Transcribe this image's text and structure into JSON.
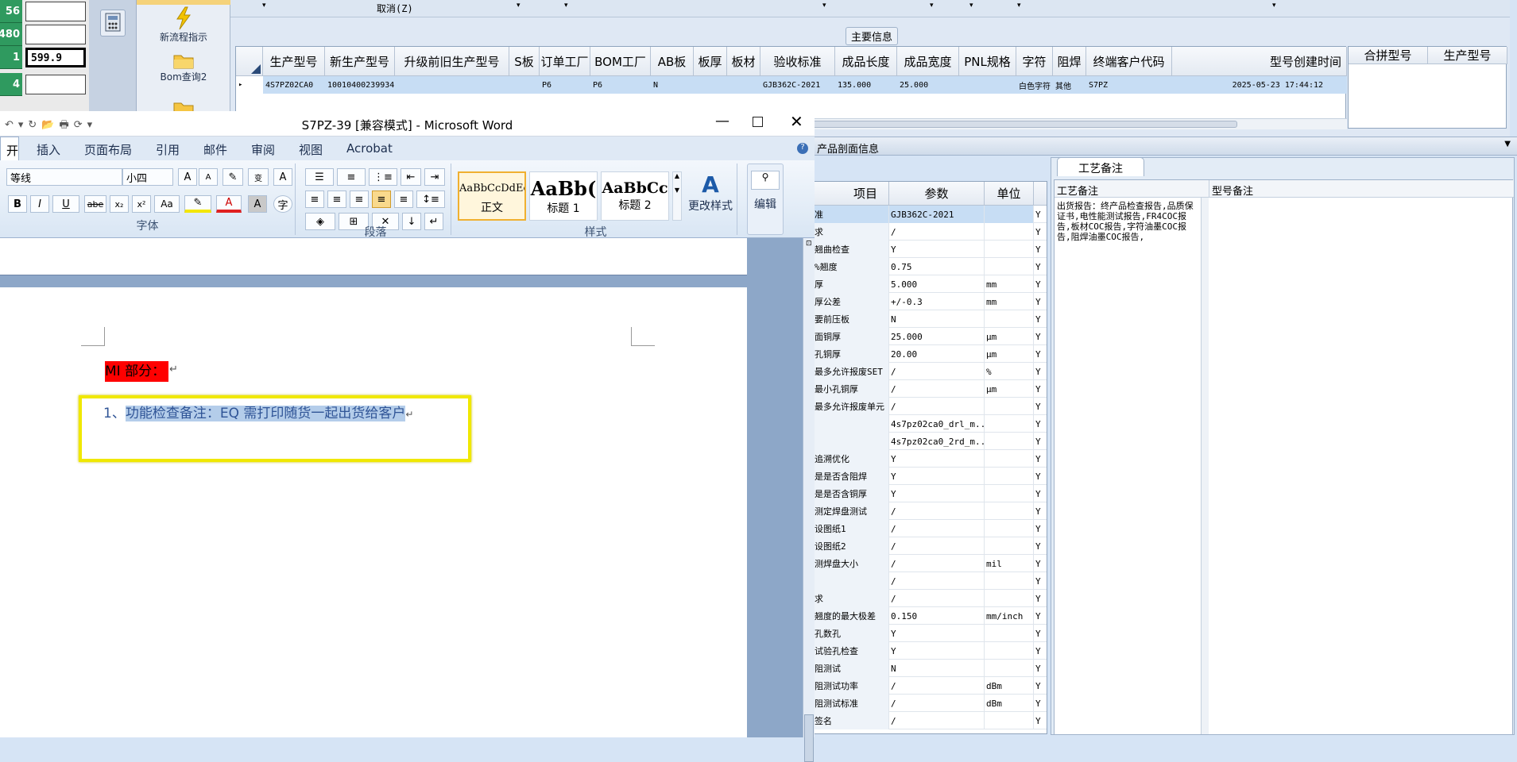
{
  "left_strip": {
    "rows": [
      {
        "num": "56",
        "value": ""
      },
      {
        "num": "480",
        "value": ""
      },
      {
        "num": "1",
        "value": "599.9"
      },
      {
        "num": "4",
        "value": ""
      }
    ],
    "tools": [
      {
        "label": "新流程指示",
        "icon": "lightning-icon"
      },
      {
        "label": "Bom查询2",
        "icon": "folder-icon"
      }
    ]
  },
  "top_app": {
    "cancel_label": "取消(Z)",
    "main_info_label": "主要信息",
    "columns": [
      "生产型号",
      "新生产型号",
      "升级前旧生产型号",
      "S板",
      "订单工厂",
      "BOM工厂",
      "AB板",
      "板厚",
      "板材",
      "验收标准",
      "成品长度",
      "成品宽度",
      "PNL规格",
      "字符",
      "阻焊",
      "终端客户代码",
      "型号创建时间"
    ],
    "row": [
      "4S7PZ02CA0",
      "10010400239934",
      "",
      "",
      "P6",
      "P6",
      "N",
      "",
      "",
      "GJB362C-2021",
      "135.000",
      "25.000",
      "",
      "白色字符",
      "其他",
      "S7PZ",
      "2025-05-23 17:44:12"
    ],
    "side_columns": [
      "合拼型号",
      "生产型号"
    ]
  },
  "lower_app": {
    "section_title": "产品剖面信息",
    "param_headers": [
      "项目",
      "参数",
      "单位"
    ],
    "params": [
      {
        "item": "准",
        "value": "GJB362C-2021",
        "unit": "",
        "flag": "Y"
      },
      {
        "item": "求",
        "value": "/",
        "unit": "",
        "flag": "Y"
      },
      {
        "item": "翘曲检查",
        "value": "Y",
        "unit": "",
        "flag": "Y"
      },
      {
        "item": "翘度%",
        "value": "0.75",
        "unit": "",
        "flag": "Y"
      },
      {
        "item": "厚",
        "value": "5.000",
        "unit": "mm",
        "flag": "Y"
      },
      {
        "item": "厚公差",
        "value": "+/-0.3",
        "unit": "mm",
        "flag": "Y"
      },
      {
        "item": "要前压板",
        "value": "N",
        "unit": "",
        "flag": "Y"
      },
      {
        "item": "面铜厚",
        "value": "25.000",
        "unit": "μm",
        "flag": "Y"
      },
      {
        "item": "孔铜厚",
        "value": "20.00",
        "unit": "μm",
        "flag": "Y"
      },
      {
        "item": "最多允许报废SET",
        "value": "/",
        "unit": "%",
        "flag": "Y"
      },
      {
        "item": "最小孔铜厚",
        "value": "/",
        "unit": "μm",
        "flag": "Y"
      },
      {
        "item": "最多允许报废单元",
        "value": "/",
        "unit": "",
        "flag": "Y"
      },
      {
        "item": "",
        "value": "4s7pz02ca0_drl_m...",
        "unit": "",
        "flag": "Y"
      },
      {
        "item": "",
        "value": "4s7pz02ca0_2rd_m...",
        "unit": "",
        "flag": "Y"
      },
      {
        "item": "追溯优化",
        "value": "Y",
        "unit": "",
        "flag": "Y"
      },
      {
        "item": "是是否含阻焊",
        "value": "Y",
        "unit": "",
        "flag": "Y"
      },
      {
        "item": "是是否含铜厚",
        "value": "Y",
        "unit": "",
        "flag": "Y"
      },
      {
        "item": "测定焊盘测试",
        "value": "/",
        "unit": "",
        "flag": "Y"
      },
      {
        "item": "设图纸1",
        "value": "/",
        "unit": "",
        "flag": "Y"
      },
      {
        "item": "设图纸2",
        "value": "/",
        "unit": "",
        "flag": "Y"
      },
      {
        "item": "测焊盘大小",
        "value": "/",
        "unit": "mil",
        "flag": "Y"
      },
      {
        "item": "",
        "value": "/",
        "unit": "",
        "flag": "Y"
      },
      {
        "item": "求",
        "value": "/",
        "unit": "",
        "flag": "Y"
      },
      {
        "item": "翘度的最大极差",
        "value": "0.150",
        "unit": "mm/inch",
        "flag": "Y"
      },
      {
        "item": "孔数孔",
        "value": "Y",
        "unit": "",
        "flag": "Y"
      },
      {
        "item": "试验孔检查",
        "value": "Y",
        "unit": "",
        "flag": "Y"
      },
      {
        "item": "阻测试",
        "value": "N",
        "unit": "",
        "flag": "Y"
      },
      {
        "item": "阻测试功率",
        "value": "/",
        "unit": "dBm",
        "flag": "Y"
      },
      {
        "item": "阻测试标准",
        "value": "/",
        "unit": "dBm",
        "flag": "Y"
      },
      {
        "item": "签名",
        "value": "/",
        "unit": "",
        "flag": "Y"
      }
    ],
    "notes_tab": "工艺备注",
    "notes_headers": [
      "工艺备注",
      "型号备注"
    ],
    "notes_text": "出货报告：终产品检查报告,品质保证书,电性能测试报告,FR4COC报告,板材COC报告,字符油墨COC报告,阻焊油墨COC报告,"
  },
  "word": {
    "title": "S7PZ-39 [兼容模式] - Microsoft Word",
    "tabs": [
      "开始",
      "插入",
      "页面布局",
      "引用",
      "邮件",
      "审阅",
      "视图",
      "Acrobat"
    ],
    "font_name": "等线",
    "font_size": "小四",
    "group_font": "字体",
    "group_paragraph": "段落",
    "group_styles": "样式",
    "styles": [
      {
        "preview": "AaBbCcDdEe",
        "label": "正文"
      },
      {
        "preview": "AaBb(",
        "label": "标题 1"
      },
      {
        "preview": "AaBbCc",
        "label": "标题 2"
      }
    ],
    "change_styles": "更改样式",
    "edit": "编辑",
    "heading_text": "MI 部分：",
    "list_number": "1、",
    "list_text": "功能检查备注：EQ 需打印随货一起出货给客户",
    "highlight_color": "#ff0000",
    "accent_box_color": "#f0e800"
  }
}
